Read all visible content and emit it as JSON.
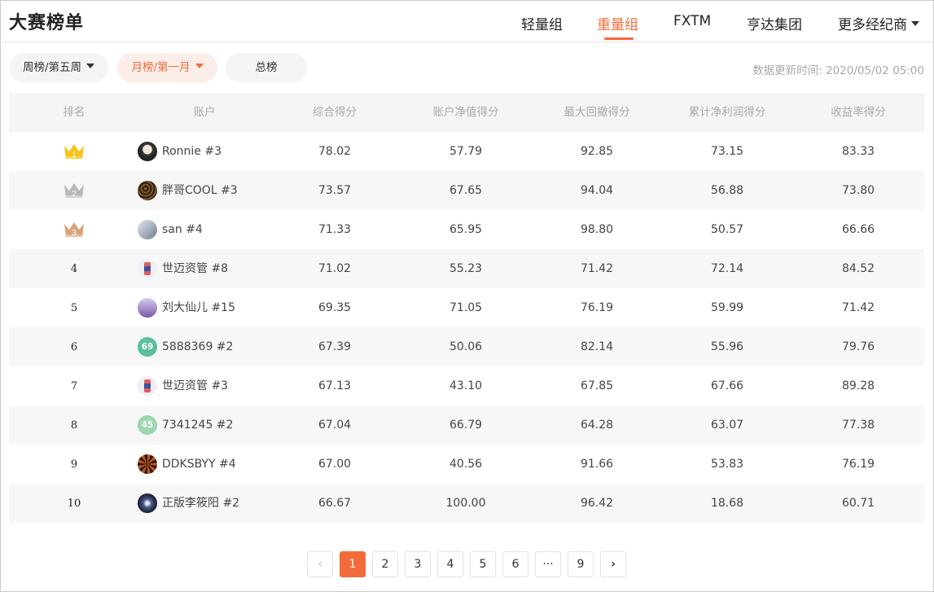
{
  "header": {
    "title": "大赛榜单",
    "tabs": [
      {
        "label": "轻量组",
        "active": false
      },
      {
        "label": "重量组",
        "active": true
      },
      {
        "label": "FXTM",
        "active": false
      },
      {
        "label": "亨达集团",
        "active": false
      },
      {
        "label": "更多经纪商",
        "active": false
      }
    ],
    "accent_color": "#f26b3a"
  },
  "filters": {
    "weekly": "周榜/第五周",
    "monthly": "月榜/第一月",
    "overall": "总榜",
    "update_time": "数据更新时间: 2020/05/02 05:00"
  },
  "table": {
    "columns": [
      "排名",
      "账户",
      "综合得分",
      "账户净值得分",
      "最大回撤得分",
      "累计净利润得分",
      "收益率得分"
    ],
    "rows": [
      {
        "rank": "1",
        "account": "Ronnie #3",
        "s1": "78.02",
        "s2": "57.79",
        "s3": "92.85",
        "s4": "73.15",
        "s5": "83.33"
      },
      {
        "rank": "2",
        "account": "胖哥COOL #3",
        "s1": "73.57",
        "s2": "67.65",
        "s3": "94.04",
        "s4": "56.88",
        "s5": "73.80"
      },
      {
        "rank": "3",
        "account": "san #4",
        "s1": "71.33",
        "s2": "65.95",
        "s3": "98.80",
        "s4": "50.57",
        "s5": "66.66"
      },
      {
        "rank": "4",
        "account": "世迈资管 #8",
        "s1": "71.02",
        "s2": "55.23",
        "s3": "71.42",
        "s4": "72.14",
        "s5": "84.52"
      },
      {
        "rank": "5",
        "account": "刘大仙儿 #15",
        "s1": "69.35",
        "s2": "71.05",
        "s3": "76.19",
        "s4": "59.99",
        "s5": "71.42"
      },
      {
        "rank": "6",
        "account": "5888369 #2",
        "s1": "67.39",
        "s2": "50.06",
        "s3": "82.14",
        "s4": "55.96",
        "s5": "79.76"
      },
      {
        "rank": "7",
        "account": "世迈资管 #3",
        "s1": "67.13",
        "s2": "43.10",
        "s3": "67.85",
        "s4": "67.66",
        "s5": "89.28"
      },
      {
        "rank": "8",
        "account": "7341245 #2",
        "s1": "67.04",
        "s2": "66.79",
        "s3": "64.28",
        "s4": "63.07",
        "s5": "77.38"
      },
      {
        "rank": "9",
        "account": "DDKSBYY #4",
        "s1": "67.00",
        "s2": "40.56",
        "s3": "91.66",
        "s4": "53.83",
        "s5": "76.19"
      },
      {
        "rank": "10",
        "account": "正版李筱阳 #2",
        "s1": "66.67",
        "s2": "100.00",
        "s3": "96.42",
        "s4": "18.68",
        "s5": "60.71"
      }
    ],
    "avatar_badges": {
      "6": "69",
      "8": "45"
    }
  },
  "pagination": {
    "prev": "‹",
    "pages": [
      "1",
      "2",
      "3",
      "4",
      "5",
      "6",
      "···",
      "9"
    ],
    "next": "›",
    "current": "1"
  }
}
